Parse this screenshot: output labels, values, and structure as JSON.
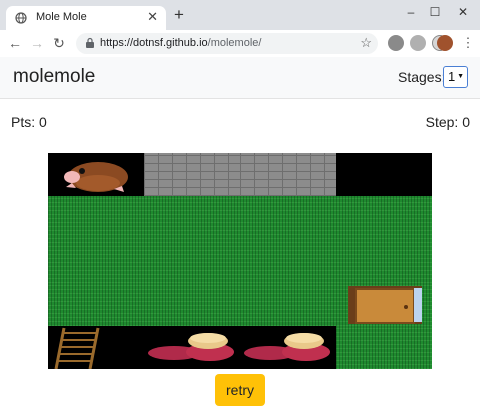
{
  "browser": {
    "tab_title": "Mole Mole",
    "url_host": "https://dotnsf.github.io",
    "url_path": "/molemole/",
    "new_tab_icon": "plus-icon",
    "close_tab_icon": "close-icon"
  },
  "header": {
    "brand": "molemole",
    "stages_label": "Stages:",
    "stage_value": "1"
  },
  "status": {
    "pts_label": "Pts:",
    "pts_value": "0",
    "step_label": "Step:",
    "step_value": "0"
  },
  "board": {
    "columns": 4,
    "rows": 5,
    "cells": [
      [
        "mole",
        "wall",
        "wall",
        "empty"
      ],
      [
        "grass",
        "grass",
        "grass",
        "grass"
      ],
      [
        "grass",
        "grass",
        "grass",
        "grass"
      ],
      [
        "grass",
        "grass",
        "grass",
        "door"
      ],
      [
        "ladder",
        "sweet-potato",
        "sweet-potato",
        "grass"
      ]
    ]
  },
  "actions": {
    "retry_label": "retry"
  },
  "colors": {
    "accent_button": "#ffc107",
    "grass": "#1f8a2f",
    "wall": "#8c8c8c",
    "board_bg": "#000000"
  }
}
